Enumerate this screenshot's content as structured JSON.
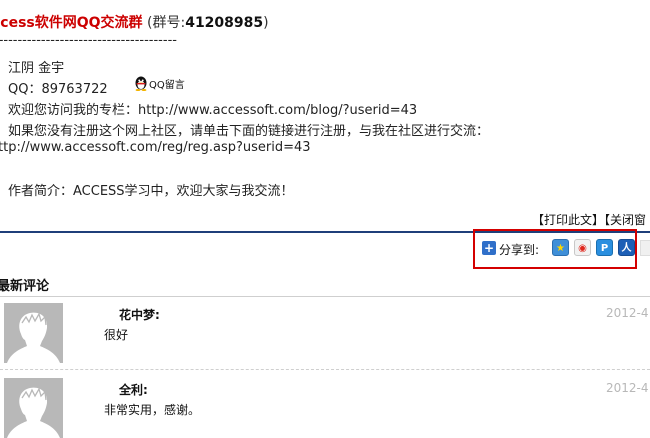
{
  "header": {
    "title": "ccess软件网QQ交流群",
    "group_prefix": " (群号:",
    "group_number": "41208985",
    "group_suffix": ")"
  },
  "divider_text": "---------------------------------------",
  "profile": {
    "line1": "江阴 金宇",
    "line2": "QQ：89763722",
    "qq_message": "QQ留言",
    "line3": "欢迎您访问我的专栏：http://www.accessoft.com/blog/?userid=43",
    "line4": "如果您没有注册这个网上社区，请单击下面的链接进行注册，与我在社区进行交流：",
    "line5": "ttp://www.accessoft.com/reg/reg.asp?userid=43",
    "line6": "作者简介：ACCESS学习中，欢迎大家与我交流！"
  },
  "actions": {
    "print": "【打印此文】",
    "close": "【关闭窗"
  },
  "share": {
    "label": "分享到:",
    "icons": [
      "qzone-icon",
      "sina-weibo-icon",
      "pengyou-icon",
      "renren-icon"
    ],
    "box_color": "#d40000"
  },
  "comments_section": {
    "title": "最新评论",
    "comments": [
      {
        "name": "花中梦:",
        "text": "很好",
        "date": "2012-4"
      },
      {
        "name": "全利:",
        "text": "非常实用，感谢。",
        "date": "2012-4"
      }
    ]
  }
}
